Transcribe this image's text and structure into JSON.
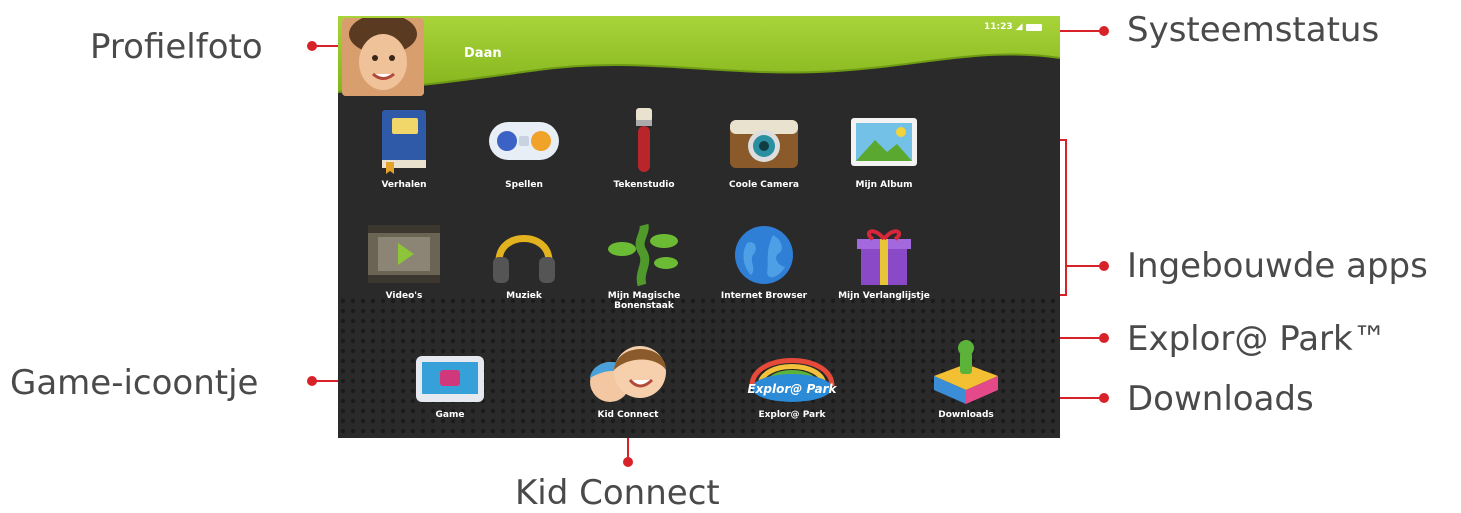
{
  "callouts": {
    "profile_photo": "Profielfoto",
    "system_status": "Systeemstatus",
    "built_in_apps": "Ingebouwde apps",
    "explor_park": "Explor@ Park™",
    "downloads": "Downloads",
    "game_icon": "Game-icoontje",
    "kid_connect": "Kid Connect"
  },
  "screen": {
    "profile_name": "Daan",
    "status_time": "11:23",
    "row1": [
      {
        "label": "Verhalen",
        "icon": "book-icon"
      },
      {
        "label": "Spellen",
        "icon": "gamepad-icon"
      },
      {
        "label": "Tekenstudio",
        "icon": "paintbrush-icon"
      },
      {
        "label": "Coole Camera",
        "icon": "camera-icon"
      },
      {
        "label": "Mijn Album",
        "icon": "photo-album-icon"
      }
    ],
    "row2": [
      {
        "label": "Video's",
        "icon": "film-icon"
      },
      {
        "label": "Muziek",
        "icon": "headphones-icon"
      },
      {
        "label": "Mijn Magische Bonenstaak",
        "icon": "beanstalk-icon"
      },
      {
        "label": "Internet Browser",
        "icon": "globe-icon"
      },
      {
        "label": "Mijn Verlanglijstje",
        "icon": "gift-icon"
      }
    ],
    "row3": [
      {
        "label": "Game",
        "icon": "game-screen-icon"
      },
      {
        "label": "Kid Connect",
        "icon": "kid-connect-icon"
      },
      {
        "label": "Explor@ Park",
        "icon": "explor-park-icon"
      },
      {
        "label": "Downloads",
        "icon": "downloads-box-icon"
      }
    ]
  },
  "colors": {
    "callout_dot": "#d8222a",
    "header_green": "#9ccd2a",
    "screen_dark": "#262626",
    "callout_text": "#4a4a4a"
  }
}
